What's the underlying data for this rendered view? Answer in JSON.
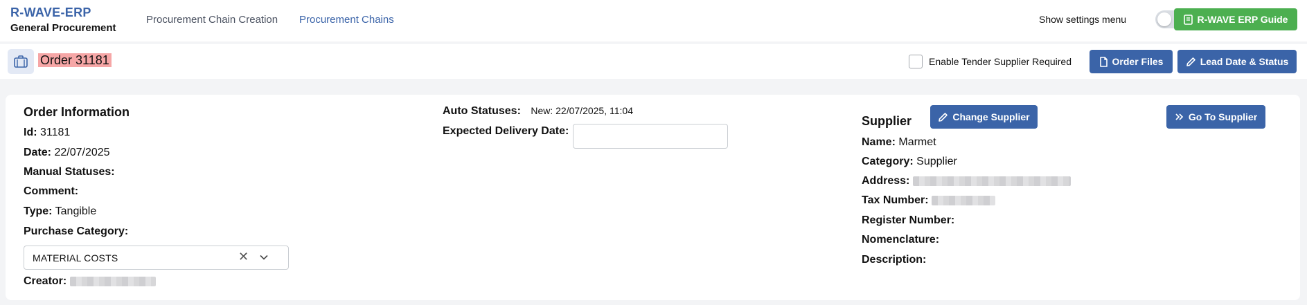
{
  "brand": {
    "name": "R-WAVE-ERP",
    "subtitle": "General Procurement"
  },
  "nav": [
    {
      "label": "Procurement Chain Creation",
      "active": false
    },
    {
      "label": "Procurement Chains",
      "active": true
    }
  ],
  "settings": {
    "label": "Show settings menu",
    "enabled": false
  },
  "guide_button": {
    "label": "R-WAVE ERP Guide"
  },
  "order_bar": {
    "title": "Order 31181",
    "checkbox_label": "Enable Tender Supplier Required",
    "checkbox_checked": false,
    "order_files_label": "Order Files",
    "lead_date_label": "Lead Date & Status"
  },
  "order_info": {
    "title": "Order Information",
    "id_key": "Id:",
    "id_value": "31181",
    "date_key": "Date:",
    "date_value": "22/07/2025",
    "manual_statuses_key": "Manual Statuses:",
    "comment_key": "Comment:",
    "type_key": "Type:",
    "type_value": "Tangible",
    "purchase_category_key": "Purchase Category:",
    "purchase_category_value": "MATERIAL COSTS",
    "creator_key": "Creator:"
  },
  "statuses": {
    "auto_key": "Auto Statuses:",
    "auto_value": "New: 22/07/2025, 11:04",
    "expected_delivery_key": "Expected Delivery Date:",
    "expected_delivery_value": ""
  },
  "supplier": {
    "title": "Supplier",
    "change_label": "Change Supplier",
    "goto_label": "Go To Supplier",
    "name_key": "Name:",
    "name_value": "Marmet",
    "category_key": "Category:",
    "category_value": "Supplier",
    "address_key": "Address:",
    "tax_key": "Tax Number:",
    "register_key": "Register Number:",
    "nomenclature_key": "Nomenclature:",
    "description_key": "Description:"
  },
  "colors": {
    "primary": "#3b64a8",
    "success": "#4caf50",
    "highlight": "#f6a6a6",
    "brand": "#3a63a8"
  }
}
